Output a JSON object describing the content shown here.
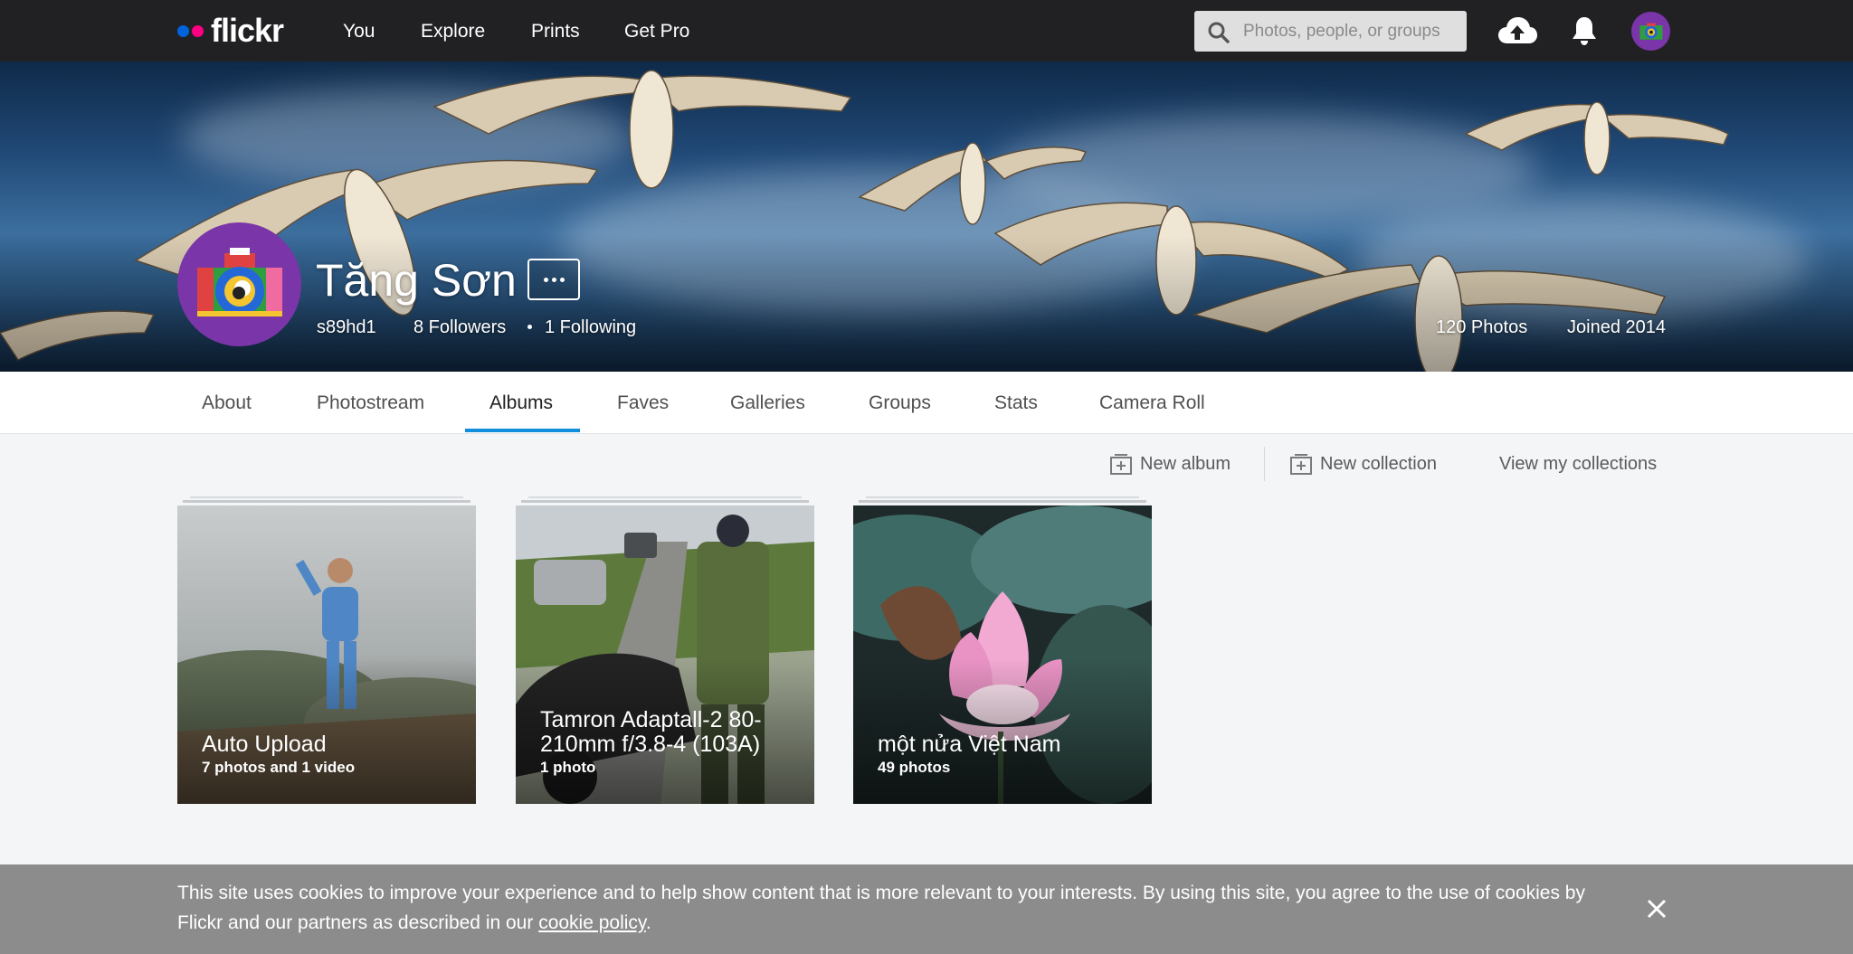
{
  "topnav": {
    "logo_text": "flickr",
    "links": [
      "You",
      "Explore",
      "Prints",
      "Get Pro"
    ],
    "search_placeholder": "Photos, people, or groups",
    "icons": [
      "upload-cloud-icon",
      "notification-bell-icon",
      "account-avatar"
    ]
  },
  "profile": {
    "name": "Tăng Sơn",
    "username": "s89hd1",
    "followers": "8 Followers",
    "following": "1 Following",
    "photos": "120 Photos",
    "joined": "Joined 2014"
  },
  "tabs": {
    "items": [
      "About",
      "Photostream",
      "Albums",
      "Faves",
      "Galleries",
      "Groups",
      "Stats",
      "Camera Roll"
    ],
    "active": "Albums"
  },
  "actions": {
    "new_album": "New album",
    "new_collection": "New collection",
    "view_collections": "View my collections"
  },
  "albums": [
    {
      "title": "Auto Upload",
      "count": "7 photos and 1 video"
    },
    {
      "title": "Tamron Adaptall-2 80-210mm f/3.8-4 (103A)",
      "count": "1 photo"
    },
    {
      "title": "một nửa Việt Nam",
      "count": "49 photos"
    }
  ],
  "cookie": {
    "text_before": "This site uses cookies to improve your experience and to help show content that is more relevant to your interests. By using this site, you agree to the use of cookies by Flickr and our partners as described in our ",
    "link": "cookie policy",
    "text_after": "."
  },
  "colors": {
    "nav_bg": "#212124",
    "accent_blue": "#128fdc",
    "logo_blue": "#0063dc",
    "logo_pink": "#ff0084",
    "cookie_bg": "#8c8c8c"
  }
}
